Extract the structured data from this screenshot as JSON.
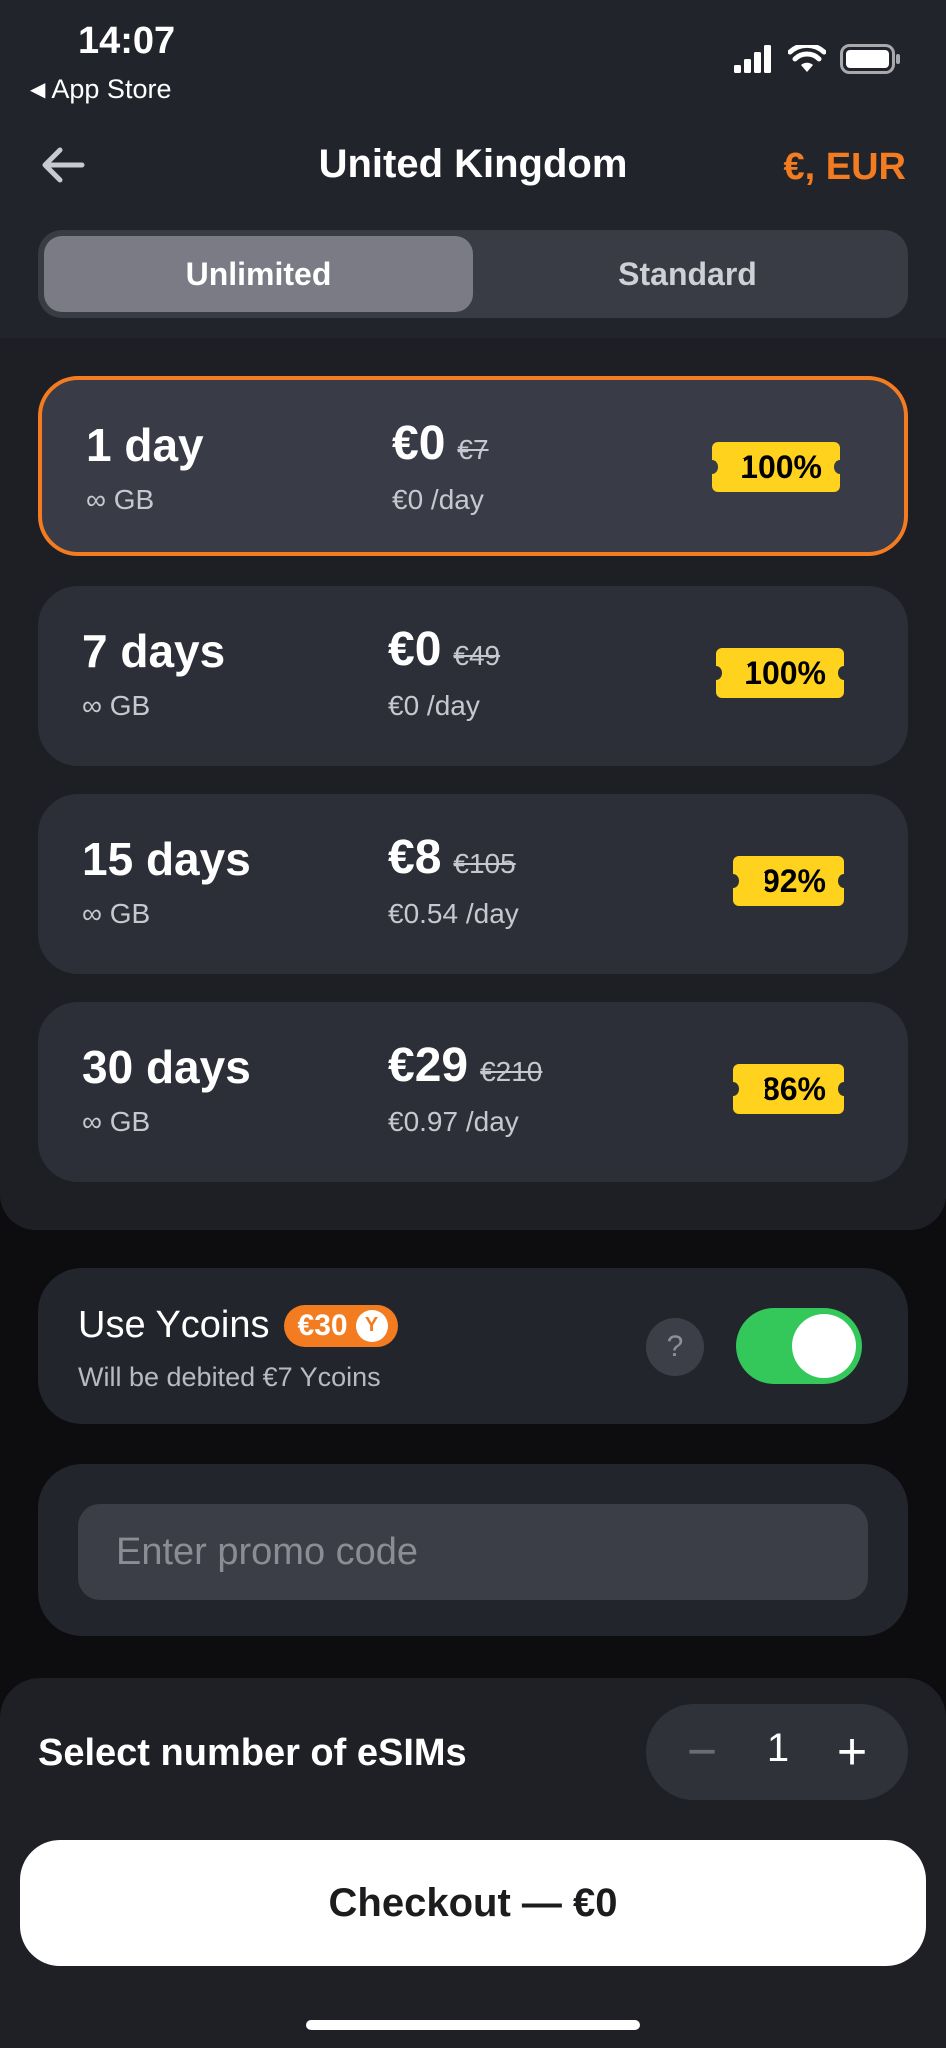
{
  "status_bar": {
    "time": "14:07",
    "back_label": "App Store"
  },
  "header": {
    "title": "United Kingdom",
    "currency": "€, EUR"
  },
  "tabs": [
    {
      "label": "Unlimited",
      "active": true
    },
    {
      "label": "Standard",
      "active": false
    }
  ],
  "plans": [
    {
      "days": "1 day",
      "gb": "∞ GB",
      "price": "€0",
      "old_price": "€7",
      "per_day": "€0 /day",
      "discount": "-100%",
      "selected": true
    },
    {
      "days": "7 days",
      "gb": "∞ GB",
      "price": "€0",
      "old_price": "€49",
      "per_day": "€0 /day",
      "discount": "-100%",
      "selected": false
    },
    {
      "days": "15 days",
      "gb": "∞ GB",
      "price": "€8",
      "old_price": "€105",
      "per_day": "€0.54 /day",
      "discount": "-92%",
      "selected": false
    },
    {
      "days": "30 days",
      "gb": "∞ GB",
      "price": "€29",
      "old_price": "€210",
      "per_day": "€0.97 /day",
      "discount": "-86%",
      "selected": false
    }
  ],
  "ycoins": {
    "label": "Use Ycoins",
    "balance": "€30",
    "subtitle": "Will be debited €7 Ycoins",
    "help": "?",
    "enabled": true
  },
  "promo": {
    "placeholder": "Enter promo code",
    "value": ""
  },
  "esims": {
    "label": "Select number of eSIMs",
    "count": "1",
    "minus": "−",
    "plus": "+"
  },
  "checkout": {
    "label": "Checkout — €0"
  },
  "colors": {
    "accent": "#f47c20",
    "badge": "#ffd21e",
    "toggle_on": "#34c759"
  }
}
